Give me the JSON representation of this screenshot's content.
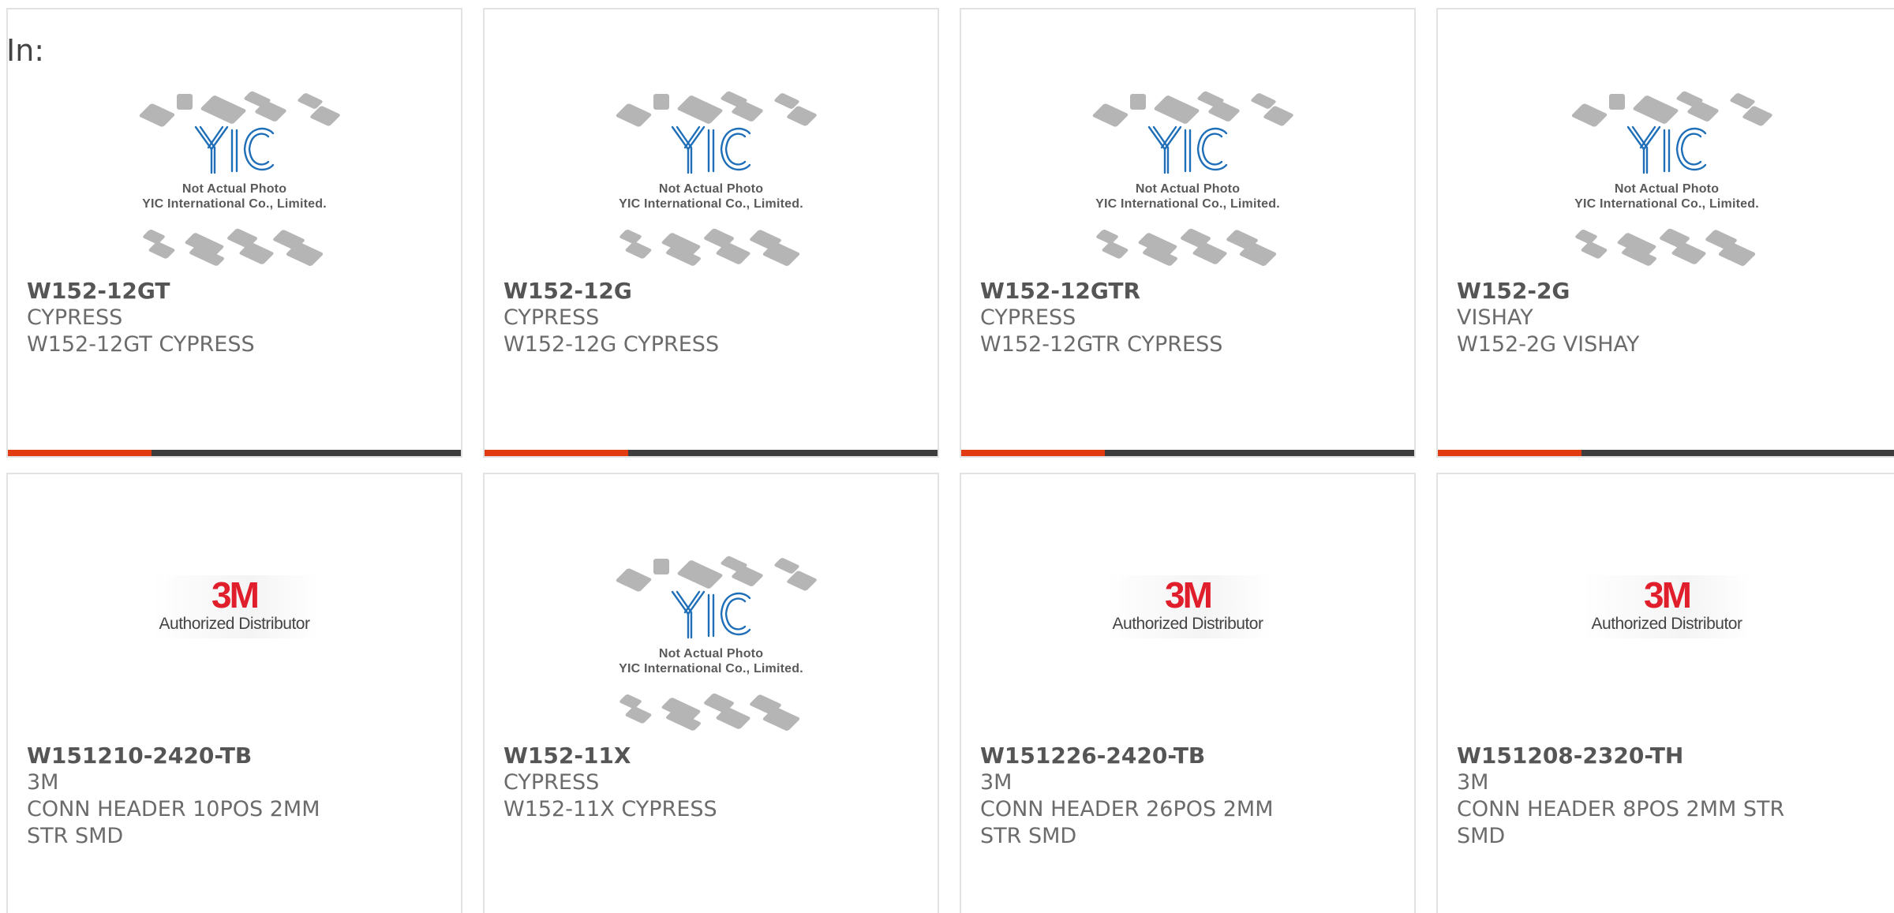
{
  "header": {
    "in_label": "In:"
  },
  "placeholder": {
    "caption_line1": "Not Actual Photo",
    "caption_line2": "YIC International Co., Limited."
  },
  "brand_logo": {
    "brand": "3M",
    "subtitle": "Authorized Distributor"
  },
  "products": [
    {
      "part_number": "W152-12GT",
      "manufacturer": "CYPRESS",
      "description": "W152-12GT CYPRESS",
      "image": "yic-placeholder"
    },
    {
      "part_number": "W152-12G",
      "manufacturer": "CYPRESS",
      "description": "W152-12G CYPRESS",
      "image": "yic-placeholder"
    },
    {
      "part_number": "W152-12GTR",
      "manufacturer": "CYPRESS",
      "description": "W152-12GTR CYPRESS",
      "image": "yic-placeholder"
    },
    {
      "part_number": "W152-2G",
      "manufacturer": "VISHAY",
      "description": "W152-2G VISHAY",
      "image": "yic-placeholder"
    },
    {
      "part_number": "W151210-2420-TB",
      "manufacturer": "3M",
      "description": "CONN HEADER 10POS 2MM STR SMD",
      "image": "3m-logo"
    },
    {
      "part_number": "W152-11X",
      "manufacturer": "CYPRESS",
      "description": "W152-11X CYPRESS",
      "image": "yic-placeholder"
    },
    {
      "part_number": "W151226-2420-TB",
      "manufacturer": "3M",
      "description": "CONN HEADER 26POS 2MM STR SMD",
      "image": "3m-logo"
    },
    {
      "part_number": "W151208-2320-TH",
      "manufacturer": "3M",
      "description": "CONN HEADER 8POS 2MM STR SMD",
      "image": "3m-logo"
    }
  ],
  "colors": {
    "accent": "#e23b12",
    "bar": "#3d3d3d",
    "yic_blue": "#1f6fb8",
    "brand_red": "#e01e2c"
  }
}
